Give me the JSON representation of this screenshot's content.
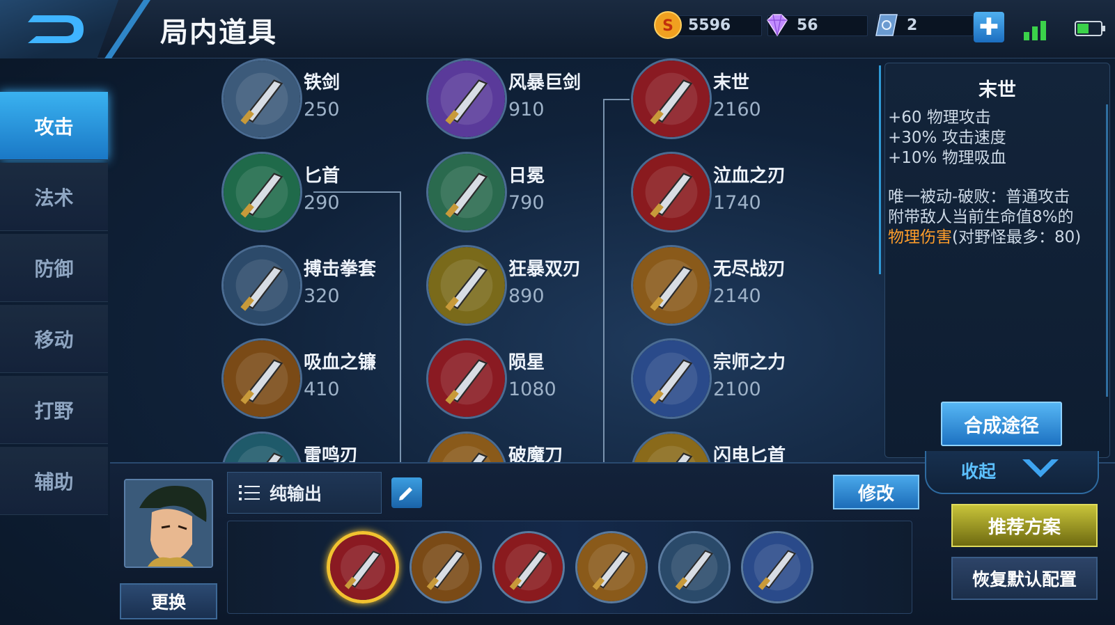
{
  "header": {
    "title": "局内道具",
    "gold": "5596",
    "diamonds": "56",
    "vouchers": "2"
  },
  "sidebar": {
    "items": [
      {
        "label": "攻击",
        "active": true
      },
      {
        "label": "法术"
      },
      {
        "label": "防御"
      },
      {
        "label": "移动"
      },
      {
        "label": "打野"
      },
      {
        "label": "辅助"
      }
    ]
  },
  "items": [
    {
      "name": "铁剑",
      "price": "250",
      "icon": "sword-icon",
      "color": "#3c5a7a"
    },
    {
      "name": "风暴巨剑",
      "price": "910",
      "icon": "great-sword-icon",
      "color": "#5a3a9a"
    },
    {
      "name": "末世",
      "price": "2160",
      "icon": "doom-blade-icon",
      "color": "#8a1a22"
    },
    {
      "name": "匕首",
      "price": "290",
      "icon": "dagger-icon",
      "color": "#1f6a4a"
    },
    {
      "name": "日冕",
      "price": "790",
      "icon": "corona-icon",
      "color": "#2a6a4e"
    },
    {
      "name": "泣血之刃",
      "price": "1740",
      "icon": "bloody-blade-icon",
      "color": "#8a1a1e"
    },
    {
      "name": "搏击拳套",
      "price": "320",
      "icon": "gauntlet-icon",
      "color": "#2c4a6a"
    },
    {
      "name": "狂暴双刃",
      "price": "890",
      "icon": "twin-blade-icon",
      "color": "#7a6a1a"
    },
    {
      "name": "无尽战刃",
      "price": "2140",
      "icon": "infinity-edge-icon",
      "color": "#8a5a1a"
    },
    {
      "name": "吸血之镰",
      "price": "410",
      "icon": "scythe-icon",
      "color": "#7a4a16"
    },
    {
      "name": "陨星",
      "price": "1080",
      "icon": "meteor-icon",
      "color": "#8a1a22"
    },
    {
      "name": "宗师之力",
      "price": "2100",
      "icon": "master-power-icon",
      "color": "#2a4a8a"
    },
    {
      "name": "雷鸣刃",
      "price": "",
      "icon": "thunder-blade-icon",
      "color": "#1f5a6a"
    },
    {
      "name": "破魔刀",
      "price": "",
      "icon": "magic-breaker-icon",
      "color": "#8a5a1a"
    },
    {
      "name": "闪电匕首",
      "price": "",
      "icon": "lightning-dagger-icon",
      "color": "#8a6a1a"
    }
  ],
  "detail": {
    "title": "末世",
    "stats": [
      "+60 物理攻击",
      "+30% 攻击速度",
      "+10% 物理吸血"
    ],
    "passive_line1": "唯一被动-破败：普通攻击",
    "passive_line2": "附带敌人当前生命值8%的",
    "passive_highlight": "物理伤害",
    "passive_rest": "(对野怪最多：80)",
    "compose_label": "合成途径",
    "highlight_color": "#ff9d2a"
  },
  "bottom": {
    "swap_label": "更换",
    "preset_label": "纯输出",
    "modify_label": "修改",
    "collapse_label": "收起",
    "recommend_label": "推荐方案",
    "default_label": "恢复默认配置",
    "slots": [
      {
        "icon": "doom-blade-icon",
        "color": "#8a1a22",
        "selected": true
      },
      {
        "icon": "boots-icon",
        "color": "#7a4a16"
      },
      {
        "icon": "bloody-blade-icon",
        "color": "#8a1a1e"
      },
      {
        "icon": "infinity-edge-icon",
        "color": "#8a5a1a"
      },
      {
        "icon": "bow-icon",
        "color": "#2a4a6a"
      },
      {
        "icon": "armor-icon",
        "color": "#2a4a8a"
      }
    ]
  }
}
